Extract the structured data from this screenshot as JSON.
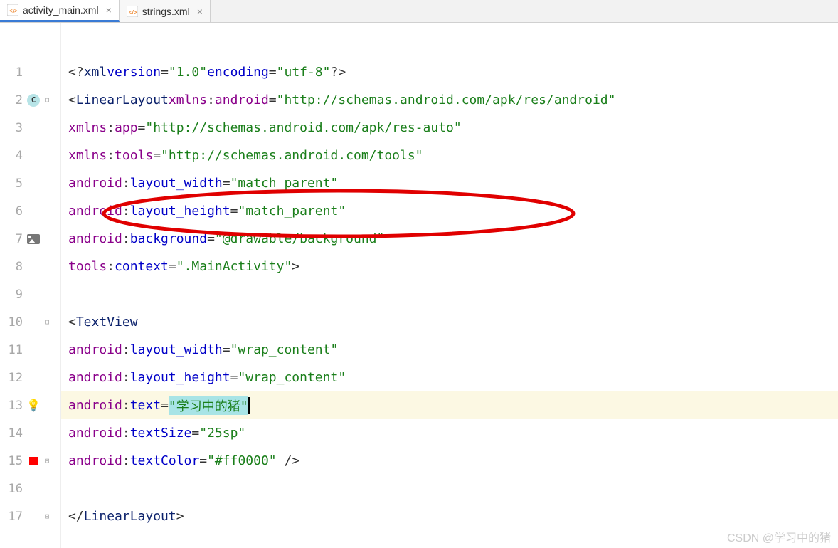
{
  "tabs": [
    {
      "label": "activity_main.xml",
      "active": true
    },
    {
      "label": "strings.xml",
      "active": false
    }
  ],
  "lines": {
    "pi_pre": "<?",
    "pi_xml": "xml",
    "pi_ver_attr": "version",
    "pi_ver_val": "\"1.0\"",
    "pi_enc_attr": "encoding",
    "pi_enc_val": "\"utf-8\"",
    "pi_end": "?>",
    "lt": "<",
    "ll_tag": "LinearLayout",
    "xmlns": "xmlns",
    "ns_android": "android",
    "ns_app": "app",
    "ns_tools": "tools",
    "xmlns_android_val": "\"http://schemas.android.com/apk/res/android\"",
    "xmlns_app_val": "\"http://schemas.android.com/apk/res-auto\"",
    "xmlns_tools_val": "\"http://schemas.android.com/tools\"",
    "layout_width": "layout_width",
    "layout_height": "layout_height",
    "match_parent": "\"match_parent\"",
    "background_attr": "background",
    "background_val": "\"@drawable/background\"",
    "context_attr": "context",
    "context_val": "\".MainActivity\"",
    "gt": ">",
    "tv_tag": "TextView",
    "wrap_content": "\"wrap_content\"",
    "text_attr": "text",
    "text_val": "\"学习中的猪\"",
    "textSize_attr": "textSize",
    "textSize_val": "\"25sp\"",
    "textColor_attr": "textColor",
    "textColor_val": "\"#ff0000\"",
    "self_close": " />",
    "close_ll_l": "</",
    "close_ll_r": ">"
  },
  "gutter": {
    "c_badge": "C",
    "numbers": [
      "1",
      "2",
      "3",
      "4",
      "5",
      "6",
      "7",
      "8",
      "9",
      "10",
      "11",
      "12",
      "13",
      "14",
      "15",
      "16",
      "17"
    ]
  },
  "watermark": "CSDN @\u0002\u0002\u0002学习中的猪"
}
